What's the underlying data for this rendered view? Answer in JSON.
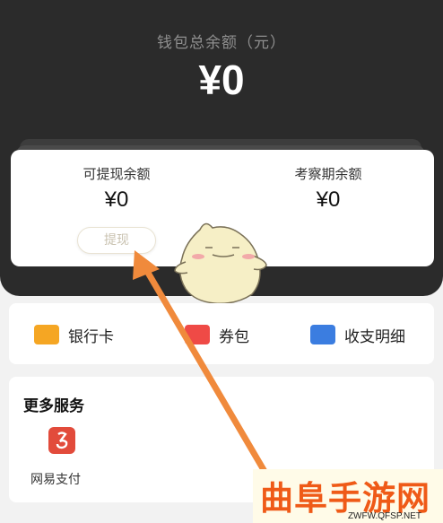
{
  "wallet": {
    "total_label": "钱包总余额（元）",
    "total_amount": "¥0"
  },
  "balances": {
    "withdrawable_label": "可提现余额",
    "withdrawable_amount": "¥0",
    "withdraw_button": "提现",
    "probation_label": "考察期余额",
    "probation_amount": "¥0"
  },
  "quick_actions": [
    {
      "label": "银行卡",
      "icon": "bank-card-icon",
      "color": "#f5a623"
    },
    {
      "label": "券包",
      "icon": "coupon-icon",
      "color": "#ef4a46"
    },
    {
      "label": "收支明细",
      "icon": "transaction-details-icon",
      "color": "#3b7de0"
    }
  ],
  "services": {
    "title": "更多服务",
    "items": [
      {
        "label": "网易支付",
        "icon": "netease-pay-icon",
        "color": "#e24b3b"
      }
    ]
  },
  "watermark": {
    "text": "曲阜手游网",
    "url": "ZWFW.QFSP.NET"
  },
  "colors": {
    "header_bg": "#2b2b2b",
    "annotation_arrow": "#f08a3c"
  }
}
